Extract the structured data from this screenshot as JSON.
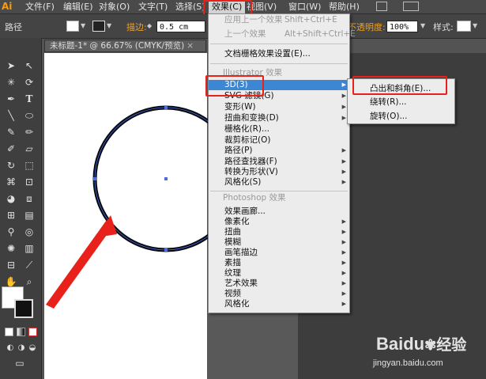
{
  "app": {
    "logo": "Ai"
  },
  "menubar": {
    "items": [
      "文件(F)",
      "编辑(E)",
      "对象(O)",
      "文字(T)",
      "选择(S)",
      "效果(C)",
      "视图(V)",
      "窗口(W)",
      "帮助(H)"
    ]
  },
  "controlbar": {
    "path_label": "路径",
    "stroke_label": "描边:",
    "stroke_value": "0.5 cm",
    "opacity_label": "不透明度:",
    "opacity_value": "100%",
    "style_label": "样式:"
  },
  "document": {
    "tab_title": "未标题-1* @ 66.67% (CMYK/预览)",
    "close": "×"
  },
  "effect_menu": {
    "apply_last": {
      "label": "应用上一个效果",
      "shortcut": "Shift+Ctrl+E"
    },
    "last_effect": {
      "label": "上一个效果",
      "shortcut": "Alt+Shift+Ctrl+E"
    },
    "raster_settings": "文档栅格效果设置(E)...",
    "illustrator_header": "Illustrator 效果",
    "illustrator_items": [
      "3D(3)",
      "SVG 滤镜(G)",
      "变形(W)",
      "扭曲和变换(D)",
      "栅格化(R)...",
      "裁剪标记(O)",
      "路径(P)",
      "路径查找器(F)",
      "转换为形状(V)",
      "风格化(S)"
    ],
    "photoshop_header": "Photoshop 效果",
    "photoshop_items": [
      "效果画廊...",
      "像素化",
      "扭曲",
      "模糊",
      "画笔描边",
      "素描",
      "纹理",
      "艺术效果",
      "视频",
      "风格化"
    ]
  },
  "submenu_3d": {
    "items": [
      "凸出和斜角(E)...",
      "绕转(R)...",
      "旋转(O)..."
    ]
  },
  "watermark": {
    "brand": "Baidu",
    "brand_cn": "经验",
    "url": "jingyan.baidu.com"
  },
  "colors": {
    "highlight": "#3d86d4",
    "annotation": "#e8221b",
    "menu_bg": "#ececec"
  }
}
